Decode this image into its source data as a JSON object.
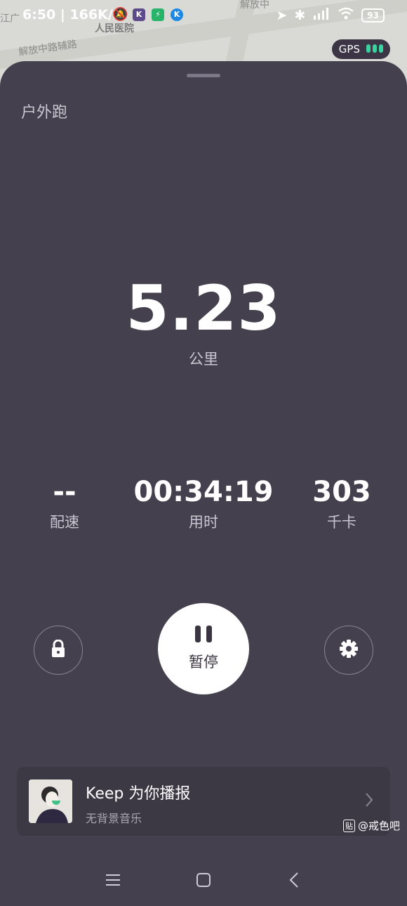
{
  "map": {
    "labels": [
      "江广",
      "人民医院",
      "解放中路辅路",
      "解放中"
    ]
  },
  "status_bar": {
    "time": "6:50",
    "speed": "166K/s",
    "battery": "93",
    "app_icon_1": "K",
    "app_icon_3": "K"
  },
  "gps": {
    "label": "GPS"
  },
  "sheet": {
    "title": "户外跑",
    "distance_value": "5.23",
    "distance_unit": "公里",
    "stats": [
      {
        "value": "--",
        "label": "配速"
      },
      {
        "value": "00:34:19",
        "label": "用时"
      },
      {
        "value": "303",
        "label": "千卡"
      }
    ],
    "pause_label": "暂停"
  },
  "card": {
    "title": "Keep 为你播报",
    "subtitle": "无背景音乐"
  },
  "watermark": {
    "badge": "贴",
    "text": "@戒色吧"
  },
  "colors": {
    "sheet_bg": "#45404d",
    "gps_green": "#3ad29f"
  }
}
